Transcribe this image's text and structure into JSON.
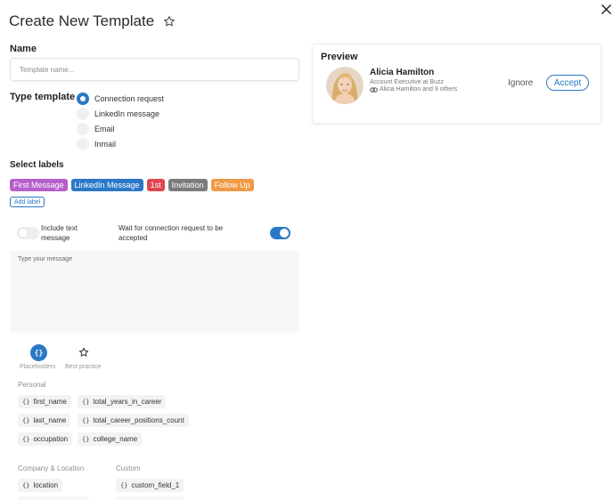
{
  "header": {
    "title": "Create New Template",
    "favorite_icon": "star-outline-icon",
    "close_icon": "close-icon"
  },
  "form": {
    "name_label": "Name",
    "name_placeholder": "Template name...",
    "name_value": "",
    "type_label": "Type template",
    "type_options": [
      {
        "label": "Connection request",
        "checked": true
      },
      {
        "label": "LinkedIn message",
        "checked": false
      },
      {
        "label": "Email",
        "checked": false
      },
      {
        "label": "Inmail",
        "checked": false
      }
    ],
    "labels_label": "Select labels",
    "labels": [
      {
        "label": "First Message",
        "color": "#b55fcc"
      },
      {
        "label": "LinkedIn Message",
        "color": "#2b78c7"
      },
      {
        "label": "1st",
        "color": "#e0454f"
      },
      {
        "label": "Invitation",
        "color": "#7b7b7b"
      },
      {
        "label": "Follow Up",
        "color": "#ef9a45"
      }
    ],
    "add_label": "Add label",
    "include_text": {
      "label": "Include text message",
      "on": false
    },
    "wait_connection": {
      "label": "Wait for connection request to be accepted",
      "on": true
    },
    "message_placeholder": "Type your message",
    "message_value": ""
  },
  "tools": {
    "placeholders_label": "Placeholders",
    "placeholders_icon": "braces-icon",
    "best_practice_label": "Best practice",
    "best_practice_icon": "star-outline-icon"
  },
  "placeholders": {
    "personal_label": "Personal",
    "personal": [
      "first_name",
      "total_years_in_career",
      "last_name",
      "total_career_positions_count",
      "occupation",
      "college_name"
    ],
    "company_label": "Company & Location",
    "company": [
      "location"
    ],
    "custom_label": "Custom",
    "custom": [
      "custom_field_1"
    ]
  },
  "preview": {
    "title": "Preview",
    "name": "Alicia Hamilton",
    "role": "Account Executive at Buzz",
    "mutual": "Alicia Hamilton and 9 others",
    "mutual_icon": "mutual-connections-icon",
    "ignore_label": "Ignore",
    "accept_label": "Accept",
    "accent_color": "#2b78c7"
  }
}
